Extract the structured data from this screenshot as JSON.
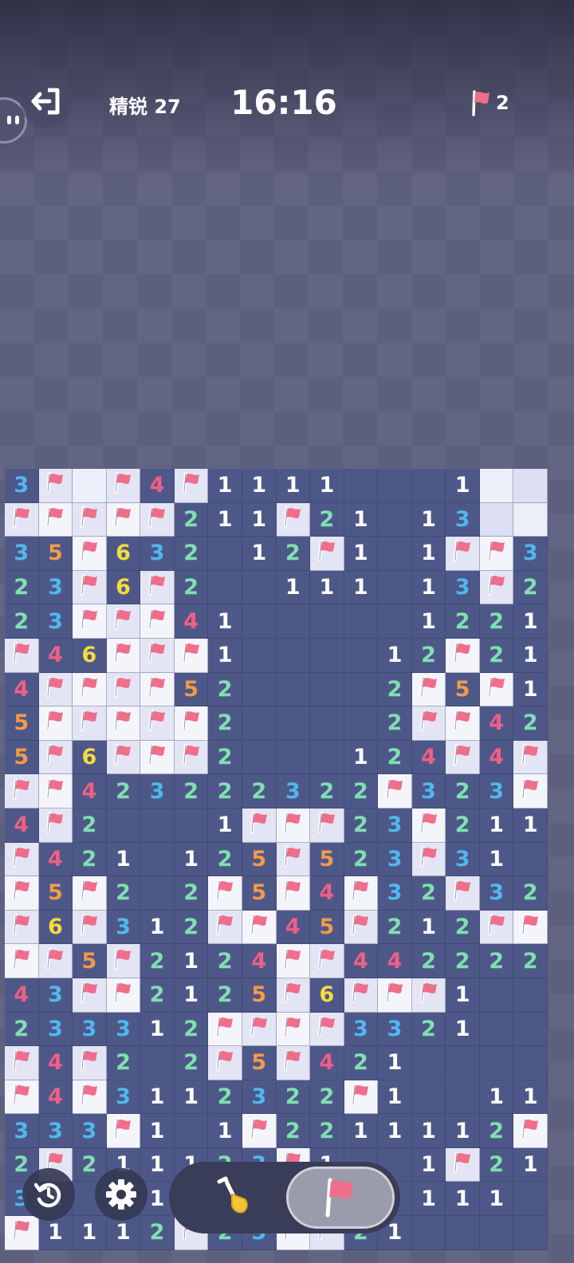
{
  "header": {
    "level_label": "精锐 27",
    "timer": "16:16",
    "flag_count": "2"
  },
  "board": {
    "rows": [
      [
        "3",
        "F",
        "C",
        "F",
        "4",
        "F",
        "1",
        "1",
        "1",
        "1",
        "",
        "",
        "",
        "1",
        "C",
        "C"
      ],
      [
        "F",
        "F",
        "F",
        "F",
        "F",
        "2",
        "1",
        "1",
        "F",
        "2",
        "1",
        "",
        "1",
        "3",
        "C",
        "C"
      ],
      [
        "3",
        "5",
        "F",
        "6",
        "3",
        "2",
        "",
        "1",
        "2",
        "F",
        "1",
        "",
        "1",
        "F",
        "F",
        "3"
      ],
      [
        "2",
        "3",
        "F",
        "6",
        "F",
        "2",
        "",
        "",
        "1",
        "1",
        "1",
        "",
        "1",
        "3",
        "F",
        "2"
      ],
      [
        "2",
        "3",
        "F",
        "F",
        "F",
        "4",
        "1",
        "",
        "",
        "",
        "",
        "",
        "1",
        "2",
        "2",
        "1"
      ],
      [
        "F",
        "4",
        "6",
        "F",
        "F",
        "F",
        "1",
        "",
        "",
        "",
        "",
        "1",
        "2",
        "F",
        "2",
        "1"
      ],
      [
        "4",
        "F",
        "F",
        "F",
        "F",
        "5",
        "2",
        "",
        "",
        "",
        "",
        "2",
        "F",
        "5",
        "F",
        "1"
      ],
      [
        "5",
        "F",
        "F",
        "F",
        "F",
        "F",
        "2",
        "",
        "",
        "",
        "",
        "2",
        "F",
        "F",
        "4",
        "2"
      ],
      [
        "5",
        "F",
        "6",
        "F",
        "F",
        "F",
        "2",
        "",
        "",
        "",
        "1",
        "2",
        "4",
        "F",
        "4",
        "F"
      ],
      [
        "F",
        "F",
        "4",
        "2",
        "3",
        "2",
        "2",
        "2",
        "3",
        "2",
        "2",
        "F",
        "3",
        "2",
        "3",
        "F"
      ],
      [
        "4",
        "F",
        "2",
        "",
        "",
        "",
        "1",
        "F",
        "F",
        "F",
        "2",
        "3",
        "F",
        "2",
        "1",
        "1"
      ],
      [
        "F",
        "4",
        "2",
        "1",
        "",
        "1",
        "2",
        "5",
        "F",
        "5",
        "2",
        "3",
        "F",
        "3",
        "1",
        ""
      ],
      [
        "F",
        "5",
        "F",
        "2",
        "",
        "2",
        "F",
        "5",
        "F",
        "4",
        "F",
        "3",
        "2",
        "F",
        "3",
        "2"
      ],
      [
        "F",
        "6",
        "F",
        "3",
        "1",
        "2",
        "F",
        "F",
        "4",
        "5",
        "F",
        "2",
        "1",
        "2",
        "F",
        "F"
      ],
      [
        "F",
        "F",
        "5",
        "F",
        "2",
        "1",
        "2",
        "4",
        "F",
        "F",
        "4",
        "4",
        "2",
        "2",
        "2",
        "2"
      ],
      [
        "4",
        "3",
        "F",
        "F",
        "2",
        "1",
        "2",
        "5",
        "F",
        "6",
        "F",
        "F",
        "F",
        "1",
        "",
        ""
      ],
      [
        "2",
        "3",
        "3",
        "3",
        "1",
        "2",
        "F",
        "F",
        "F",
        "F",
        "3",
        "3",
        "2",
        "1",
        "",
        ""
      ],
      [
        "F",
        "4",
        "F",
        "2",
        "",
        "2",
        "F",
        "5",
        "F",
        "4",
        "2",
        "1",
        "",
        "",
        "",
        ""
      ],
      [
        "F",
        "4",
        "F",
        "3",
        "1",
        "1",
        "2",
        "3",
        "2",
        "2",
        "F",
        "1",
        "",
        "",
        "1",
        "1"
      ],
      [
        "3",
        "3",
        "3",
        "F",
        "1",
        "",
        "1",
        "F",
        "2",
        "2",
        "1",
        "1",
        "1",
        "1",
        "2",
        "F"
      ],
      [
        "2",
        "F",
        "2",
        "1",
        "1",
        "1",
        "2",
        "3",
        "F",
        "1",
        "",
        "",
        "1",
        "F",
        "2",
        "1"
      ],
      [
        "3",
        "1",
        "",
        "",
        "1",
        "",
        "",
        "",
        "",
        "",
        "",
        "",
        "1",
        "1",
        "1",
        ""
      ],
      [
        "F",
        "1",
        "1",
        "1",
        "2",
        "F",
        "2",
        "3",
        "F",
        "F",
        "2",
        "1",
        "",
        "",
        "",
        ""
      ]
    ]
  },
  "controls": {
    "undo_icon": "undo-icon",
    "settings_icon": "gear-icon",
    "dig_icon": "shovel-icon",
    "flag_icon": "flag-icon"
  },
  "colors": {
    "n1": "#ffffff",
    "n2": "#7fe0b0",
    "n3": "#4fb8ee",
    "n4": "#ef5f85",
    "n5": "#f39a4a",
    "n6": "#f4dc3e",
    "flag": "#ef6e8c"
  }
}
